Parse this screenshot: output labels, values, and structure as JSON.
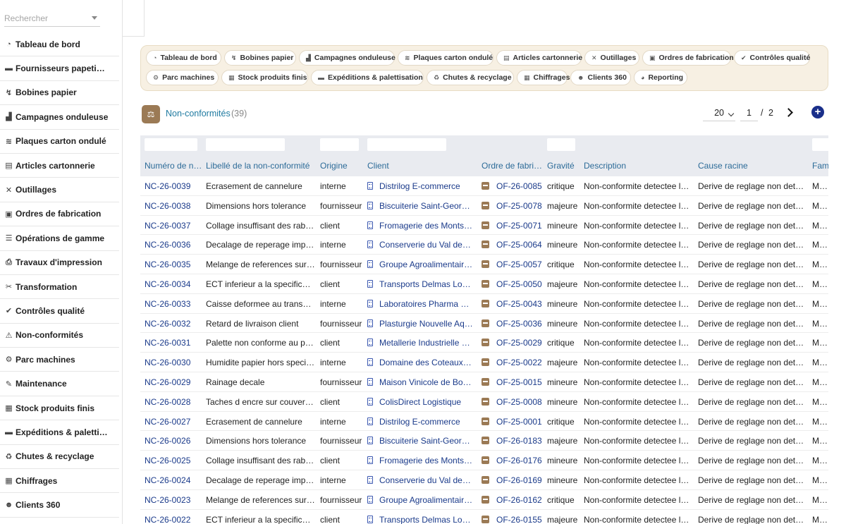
{
  "search": {
    "placeholder": "Rechercher"
  },
  "sidebar": {
    "items": [
      {
        "label": "Tableau de bord",
        "icon": "gauge-icon",
        "glyph": "◔"
      },
      {
        "label": "Fournisseurs papeti…",
        "icon": "truck-icon",
        "glyph": "▬"
      },
      {
        "label": "Bobines papier",
        "icon": "paper-roll-icon",
        "glyph": "↯"
      },
      {
        "label": "Campagnes onduleuse",
        "icon": "factory-icon",
        "glyph": "▟"
      },
      {
        "label": "Plaques carton ondulé",
        "icon": "layers-icon",
        "glyph": "≋"
      },
      {
        "label": "Articles cartonnerie",
        "icon": "box-icon",
        "glyph": "▤"
      },
      {
        "label": "Outillages",
        "icon": "tools-icon",
        "glyph": "✕"
      },
      {
        "label": "Ordres de fabrication",
        "icon": "clipboard-icon",
        "glyph": "▣"
      },
      {
        "label": "Opérations de gamme",
        "icon": "list-icon",
        "glyph": "☰"
      },
      {
        "label": "Travaux d'impression",
        "icon": "printer-icon",
        "glyph": "⎙"
      },
      {
        "label": "Transformation",
        "icon": "scissors-icon",
        "glyph": "✂"
      },
      {
        "label": "Contrôles qualité",
        "icon": "check-circle-icon",
        "glyph": "✔"
      },
      {
        "label": "Non-conformités",
        "icon": "warning-icon",
        "glyph": "⚠"
      },
      {
        "label": "Parc machines",
        "icon": "gears-icon",
        "glyph": "⚙"
      },
      {
        "label": "Maintenance",
        "icon": "wrench-icon",
        "glyph": "✎"
      },
      {
        "label": "Stock produits finis",
        "icon": "warehouse-icon",
        "glyph": "▦"
      },
      {
        "label": "Expéditions & paletti…",
        "icon": "shipping-truck-icon",
        "glyph": "▬"
      },
      {
        "label": "Chutes & recyclage",
        "icon": "recycle-icon",
        "glyph": "♻"
      },
      {
        "label": "Chiffrages",
        "icon": "calculator-icon",
        "glyph": "▦"
      },
      {
        "label": "Clients 360",
        "icon": "users-icon",
        "glyph": "☻"
      }
    ]
  },
  "modules": {
    "row1": [
      {
        "label": "Tableau de bord",
        "icon": "gauge-icon",
        "glyph": "◔"
      },
      {
        "label": "Bobines papier",
        "icon": "paper-roll-icon",
        "glyph": "↯"
      },
      {
        "label": "Campagnes onduleuse",
        "icon": "factory-icon",
        "glyph": "▟"
      },
      {
        "label": "Plaques carton ondulé",
        "icon": "layers-icon",
        "glyph": "≋"
      },
      {
        "label": "Articles cartonnerie",
        "icon": "box-icon",
        "glyph": "▤"
      },
      {
        "label": "Outillages",
        "icon": "tools-icon",
        "glyph": "✕"
      },
      {
        "label": "Ordres de fabrication",
        "icon": "clipboard-icon",
        "glyph": "▣"
      },
      {
        "label": "Contrôles qualité",
        "icon": "check-circle-icon",
        "glyph": "✔"
      }
    ],
    "row2": [
      {
        "label": "Parc machines",
        "icon": "gears-icon",
        "glyph": "⚙"
      },
      {
        "label": "Stock produits finis",
        "icon": "warehouse-icon",
        "glyph": "▦"
      },
      {
        "label": "Expéditions & palettisation",
        "icon": "shipping-truck-icon",
        "glyph": "▬"
      },
      {
        "label": "Chutes & recyclage",
        "icon": "recycle-icon",
        "glyph": "♻"
      },
      {
        "label": "Chiffrages",
        "icon": "calculator-icon",
        "glyph": "▦"
      },
      {
        "label": "Clients 360",
        "icon": "users-icon",
        "glyph": "☻"
      },
      {
        "label": "Reporting",
        "icon": "chart-pie-icon",
        "glyph": "◕"
      }
    ]
  },
  "list": {
    "title": "Non-conformités",
    "count": "(39)",
    "icon": "balance-scale-icon",
    "page_size": "20",
    "page_current": "1",
    "page_sep": "/",
    "page_total": "2",
    "add_glyph": "+"
  },
  "table": {
    "columns": [
      "Numéro de n…",
      "Libellé de la non-conformité",
      "Origine",
      "Client",
      "Ordre de fabri…",
      "Gravité",
      "Description",
      "Cause racine",
      "Fam"
    ],
    "rows": [
      [
        "NC-26-0039",
        "Ecrasement de cannelure",
        "interne",
        "Distrilog E-commerce",
        "OF-26-0085",
        "critique",
        "Non-conformite detectee lor…",
        "Derive de reglage non detec…",
        "Milie"
      ],
      [
        "NC-26-0038",
        "Dimensions hors tolerance",
        "fournisseur",
        "Biscuiterie Saint-Georges",
        "OF-25-0078",
        "majeure",
        "Non-conformite detectee lor…",
        "Derive de reglage non detec…",
        "Mach"
      ],
      [
        "NC-26-0037",
        "Collage insuffisant des rabats",
        "client",
        "Fromagerie des Monts d'…",
        "OF-25-0071",
        "mineure",
        "Non-conformite detectee lor…",
        "Derive de reglage non detec…",
        "Meth"
      ],
      [
        "NC-26-0036",
        "Decalage de reperage impr…",
        "interne",
        "Conserverie du Val de L…",
        "OF-25-0064",
        "mineure",
        "Non-conformite detectee lor…",
        "Derive de reglage non detec…",
        "Matie"
      ],
      [
        "NC-26-0035",
        "Melange de references sur …",
        "fournisseur",
        "Groupe Agroalimentaire …",
        "OF-25-0057",
        "critique",
        "Non-conformite detectee lor…",
        "Derive de reglage non detec…",
        "Main"
      ],
      [
        "NC-26-0034",
        "ECT inferieur a la specification",
        "client",
        "Transports Delmas Logis…",
        "OF-25-0050",
        "majeure",
        "Non-conformite detectee lor…",
        "Derive de reglage non detec…",
        "Milie"
      ],
      [
        "NC-26-0033",
        "Caisse deformee au transport",
        "interne",
        "Laboratoires Pharma Sa…",
        "OF-25-0043",
        "mineure",
        "Non-conformite detectee lor…",
        "Derive de reglage non detec…",
        "Mach"
      ],
      [
        "NC-26-0032",
        "Retard de livraison client",
        "fournisseur",
        "Plasturgie Nouvelle Aqui…",
        "OF-25-0036",
        "mineure",
        "Non-conformite detectee lor…",
        "Derive de reglage non detec…",
        "Meth"
      ],
      [
        "NC-26-0031",
        "Palette non conforme au plan",
        "client",
        "Metallerie Industrielle Rh…",
        "OF-25-0029",
        "critique",
        "Non-conformite detectee lor…",
        "Derive de reglage non detec…",
        "Matie"
      ],
      [
        "NC-26-0030",
        "Humidite papier hors specifi…",
        "interne",
        "Domaine des Coteaux R…",
        "OF-25-0022",
        "majeure",
        "Non-conformite detectee lor…",
        "Derive de reglage non detec…",
        "Main"
      ],
      [
        "NC-26-0029",
        "Rainage decale",
        "fournisseur",
        "Maison Vinicole de Bour…",
        "OF-25-0015",
        "mineure",
        "Non-conformite detectee lor…",
        "Derive de reglage non detec…",
        "Milie"
      ],
      [
        "NC-26-0028",
        "Taches d encre sur couverture",
        "client",
        "ColisDirect Logistique",
        "OF-25-0008",
        "mineure",
        "Non-conformite detectee lor…",
        "Derive de reglage non detec…",
        "Mach"
      ],
      [
        "NC-26-0027",
        "Ecrasement de cannelure",
        "interne",
        "Distrilog E-commerce",
        "OF-25-0001",
        "critique",
        "Non-conformite detectee lor…",
        "Derive de reglage non detec…",
        "Meth"
      ],
      [
        "NC-26-0026",
        "Dimensions hors tolerance",
        "fournisseur",
        "Biscuiterie Saint-Georges",
        "OF-26-0183",
        "majeure",
        "Non-conformite detectee lor…",
        "Derive de reglage non detec…",
        "Matie"
      ],
      [
        "NC-26-0025",
        "Collage insuffisant des rabats",
        "client",
        "Fromagerie des Monts d'…",
        "OF-26-0176",
        "mineure",
        "Non-conformite detectee lor…",
        "Derive de reglage non detec…",
        "Main"
      ],
      [
        "NC-26-0024",
        "Decalage de reperage impr…",
        "interne",
        "Conserverie du Val de L…",
        "OF-26-0169",
        "mineure",
        "Non-conformite detectee lor…",
        "Derive de reglage non detec…",
        "Milie"
      ],
      [
        "NC-26-0023",
        "Melange de references sur …",
        "fournisseur",
        "Groupe Agroalimentaire …",
        "OF-26-0162",
        "critique",
        "Non-conformite detectee lor…",
        "Derive de reglage non detec…",
        "Mach"
      ],
      [
        "NC-26-0022",
        "ECT inferieur a la specification",
        "client",
        "Transports Delmas Logis…",
        "OF-26-0155",
        "majeure",
        "Non-conformite detectee lor…",
        "Derive de reglage non detec…",
        "Meth"
      ]
    ]
  },
  "colors": {
    "accent": "#1f7aa0",
    "link": "#1a3a8a",
    "module_bar": "#f7f0e3",
    "brown": "#9b7a55",
    "add_button": "#1a2f8a"
  }
}
